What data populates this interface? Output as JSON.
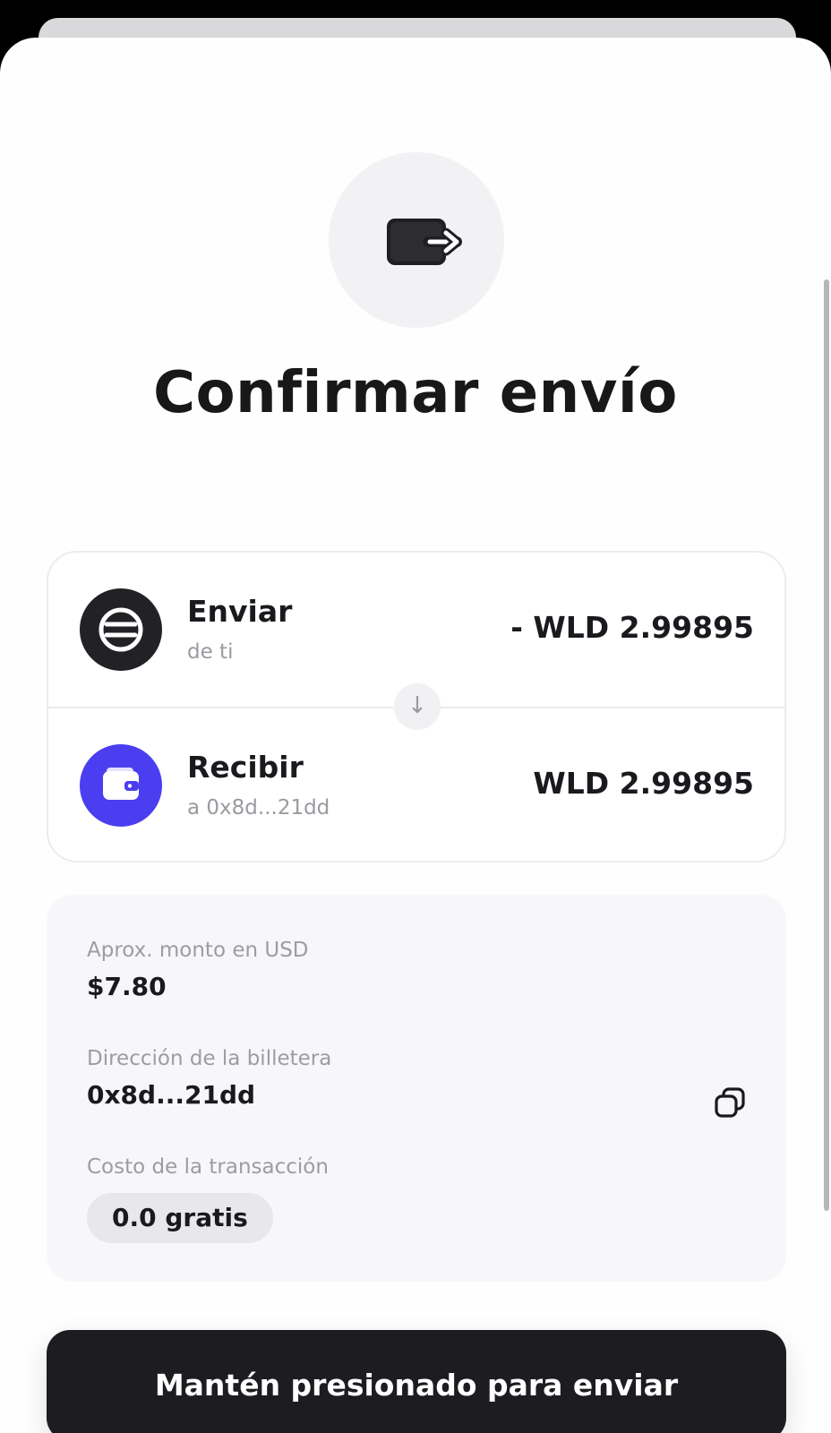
{
  "header": {
    "title": "Confirmar envío",
    "hero_icon": "wallet-send-icon"
  },
  "transaction": {
    "send": {
      "label": "Enviar",
      "subtitle": "de ti",
      "amount": "- WLD 2.99895",
      "icon": "worldcoin-icon"
    },
    "receive": {
      "label": "Recibir",
      "subtitle": "a 0x8d...21dd",
      "amount": "WLD 2.99895",
      "icon": "wallet-icon"
    },
    "divider_icon": "↓"
  },
  "details": {
    "usd_label": "Aprox. monto en USD",
    "usd_value": "$7.80",
    "wallet_label": "Dirección de la billetera",
    "wallet_value": "0x8d...21dd",
    "fee_label": "Costo de la transacción",
    "fee_value": "0.0 gratis"
  },
  "action": {
    "hold_label": "Mantén presionado para enviar"
  },
  "colors": {
    "accent_purple": "#4a3ef0",
    "button_dark": "#1c1c21",
    "avatar_dark": "#222226"
  }
}
